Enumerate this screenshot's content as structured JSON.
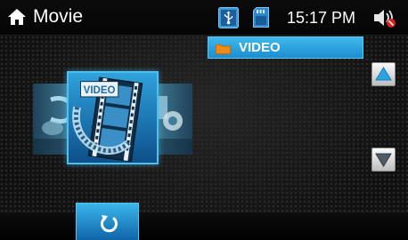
{
  "header": {
    "title": "Movie",
    "time": "15:17  PM",
    "icons": {
      "home": "home-icon",
      "usb": "usb-icon",
      "sd_card": "sd-card-icon",
      "volume": "volume-muted-icon"
    }
  },
  "browser": {
    "folder": {
      "label": "VIDEO",
      "icon": "folder-icon"
    },
    "scroll_up_icon": "triangle-up-icon",
    "scroll_down_icon": "triangle-down-icon"
  },
  "carousel": {
    "selected_label": "VIDEO",
    "items": [
      "audio",
      "video",
      "photo"
    ]
  },
  "footer": {
    "back_icon": "return-icon"
  },
  "colors": {
    "accent": "#2aa4e0",
    "accent_light": "#5cc8f2",
    "background": "#121212",
    "folder_orange": "#f28a16"
  }
}
